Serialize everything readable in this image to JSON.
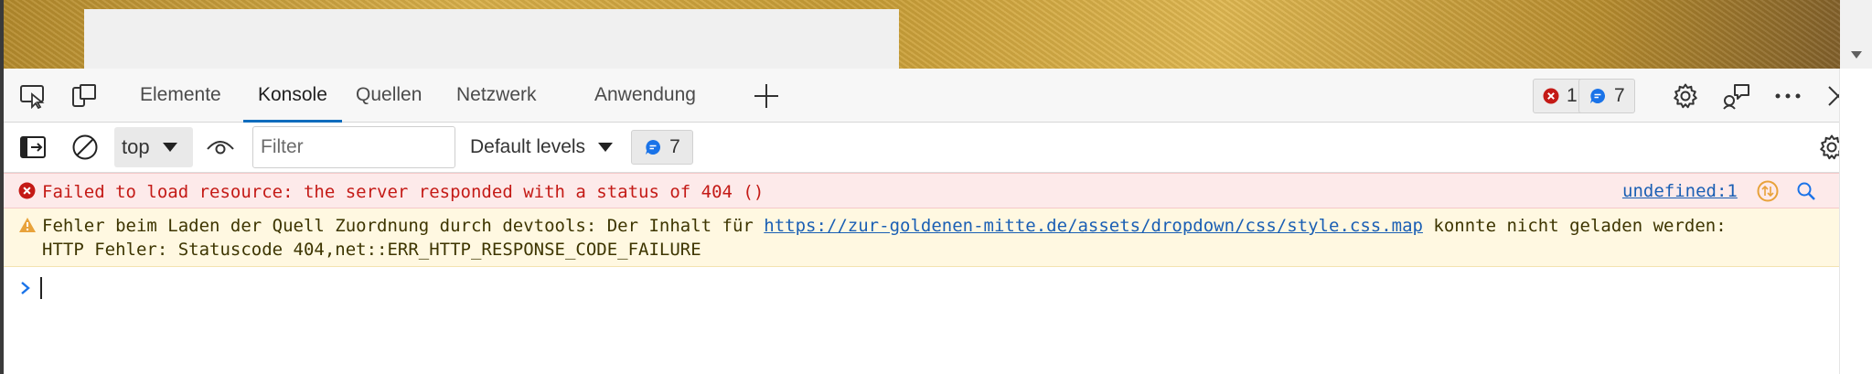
{
  "tabs": [
    {
      "label": "Elemente"
    },
    {
      "label": "Konsole",
      "active": true
    },
    {
      "label": "Quellen"
    },
    {
      "label": "Netzwerk"
    },
    {
      "label": "Anwendung"
    }
  ],
  "badges": {
    "errors": "1",
    "messages": "7"
  },
  "console_toolbar": {
    "context": "top",
    "filter_placeholder": "Filter",
    "levels": "Default levels",
    "message_count": "7"
  },
  "messages": {
    "error": {
      "text": "Failed to load resource: the server responded with a status of 404 ()",
      "source": "undefined:1"
    },
    "warning": {
      "prefix": "Fehler beim Laden der Quell Zuordnung durch devtools: Der Inhalt für ",
      "url": "https://zur-goldenen-mitte.de/assets/dropdown/css/style.css.map",
      "suffix": " konnte nicht geladen werden: HTTP Fehler: Statuscode 404,net::ERR_HTTP_RESPONSE_CODE_FAILURE"
    }
  },
  "colors": {
    "accent": "#0f6cbd",
    "error": "#c41a16",
    "error_bg": "#fdeaea",
    "warning_bg": "#fff8e1",
    "link": "#1a5fb4"
  }
}
